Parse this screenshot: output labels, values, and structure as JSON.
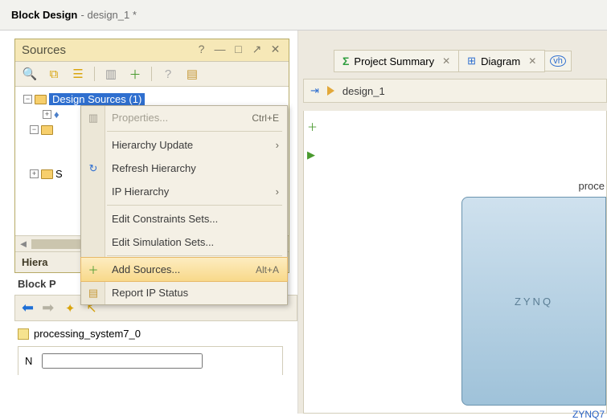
{
  "window": {
    "title_strong": "Block Design",
    "title_file": "- design_1 *"
  },
  "sources": {
    "panel_title": "Sources",
    "tree": {
      "root": "Design Sources (1)"
    },
    "bottom_tab": "Hiera"
  },
  "block_props": {
    "heading": "Block P",
    "proc_label": "processing_system7_0",
    "name_label": "N"
  },
  "ctx": {
    "properties": "Properties...",
    "properties_key": "Ctrl+E",
    "hierarchy_update": "Hierarchy Update",
    "refresh": "Refresh Hierarchy",
    "ip_hierarchy": "IP Hierarchy",
    "edit_constraints": "Edit Constraints Sets...",
    "edit_simulation": "Edit Simulation Sets...",
    "add_sources": "Add Sources...",
    "add_sources_key": "Alt+A",
    "report_ip": "Report IP Status"
  },
  "right": {
    "tab1": "Project Summary",
    "tab2": "Diagram",
    "crumb": "design_1",
    "zynq_title": "proce",
    "zynq_text": "ZYNQ",
    "zynq_sub": "ZYNQ7"
  }
}
